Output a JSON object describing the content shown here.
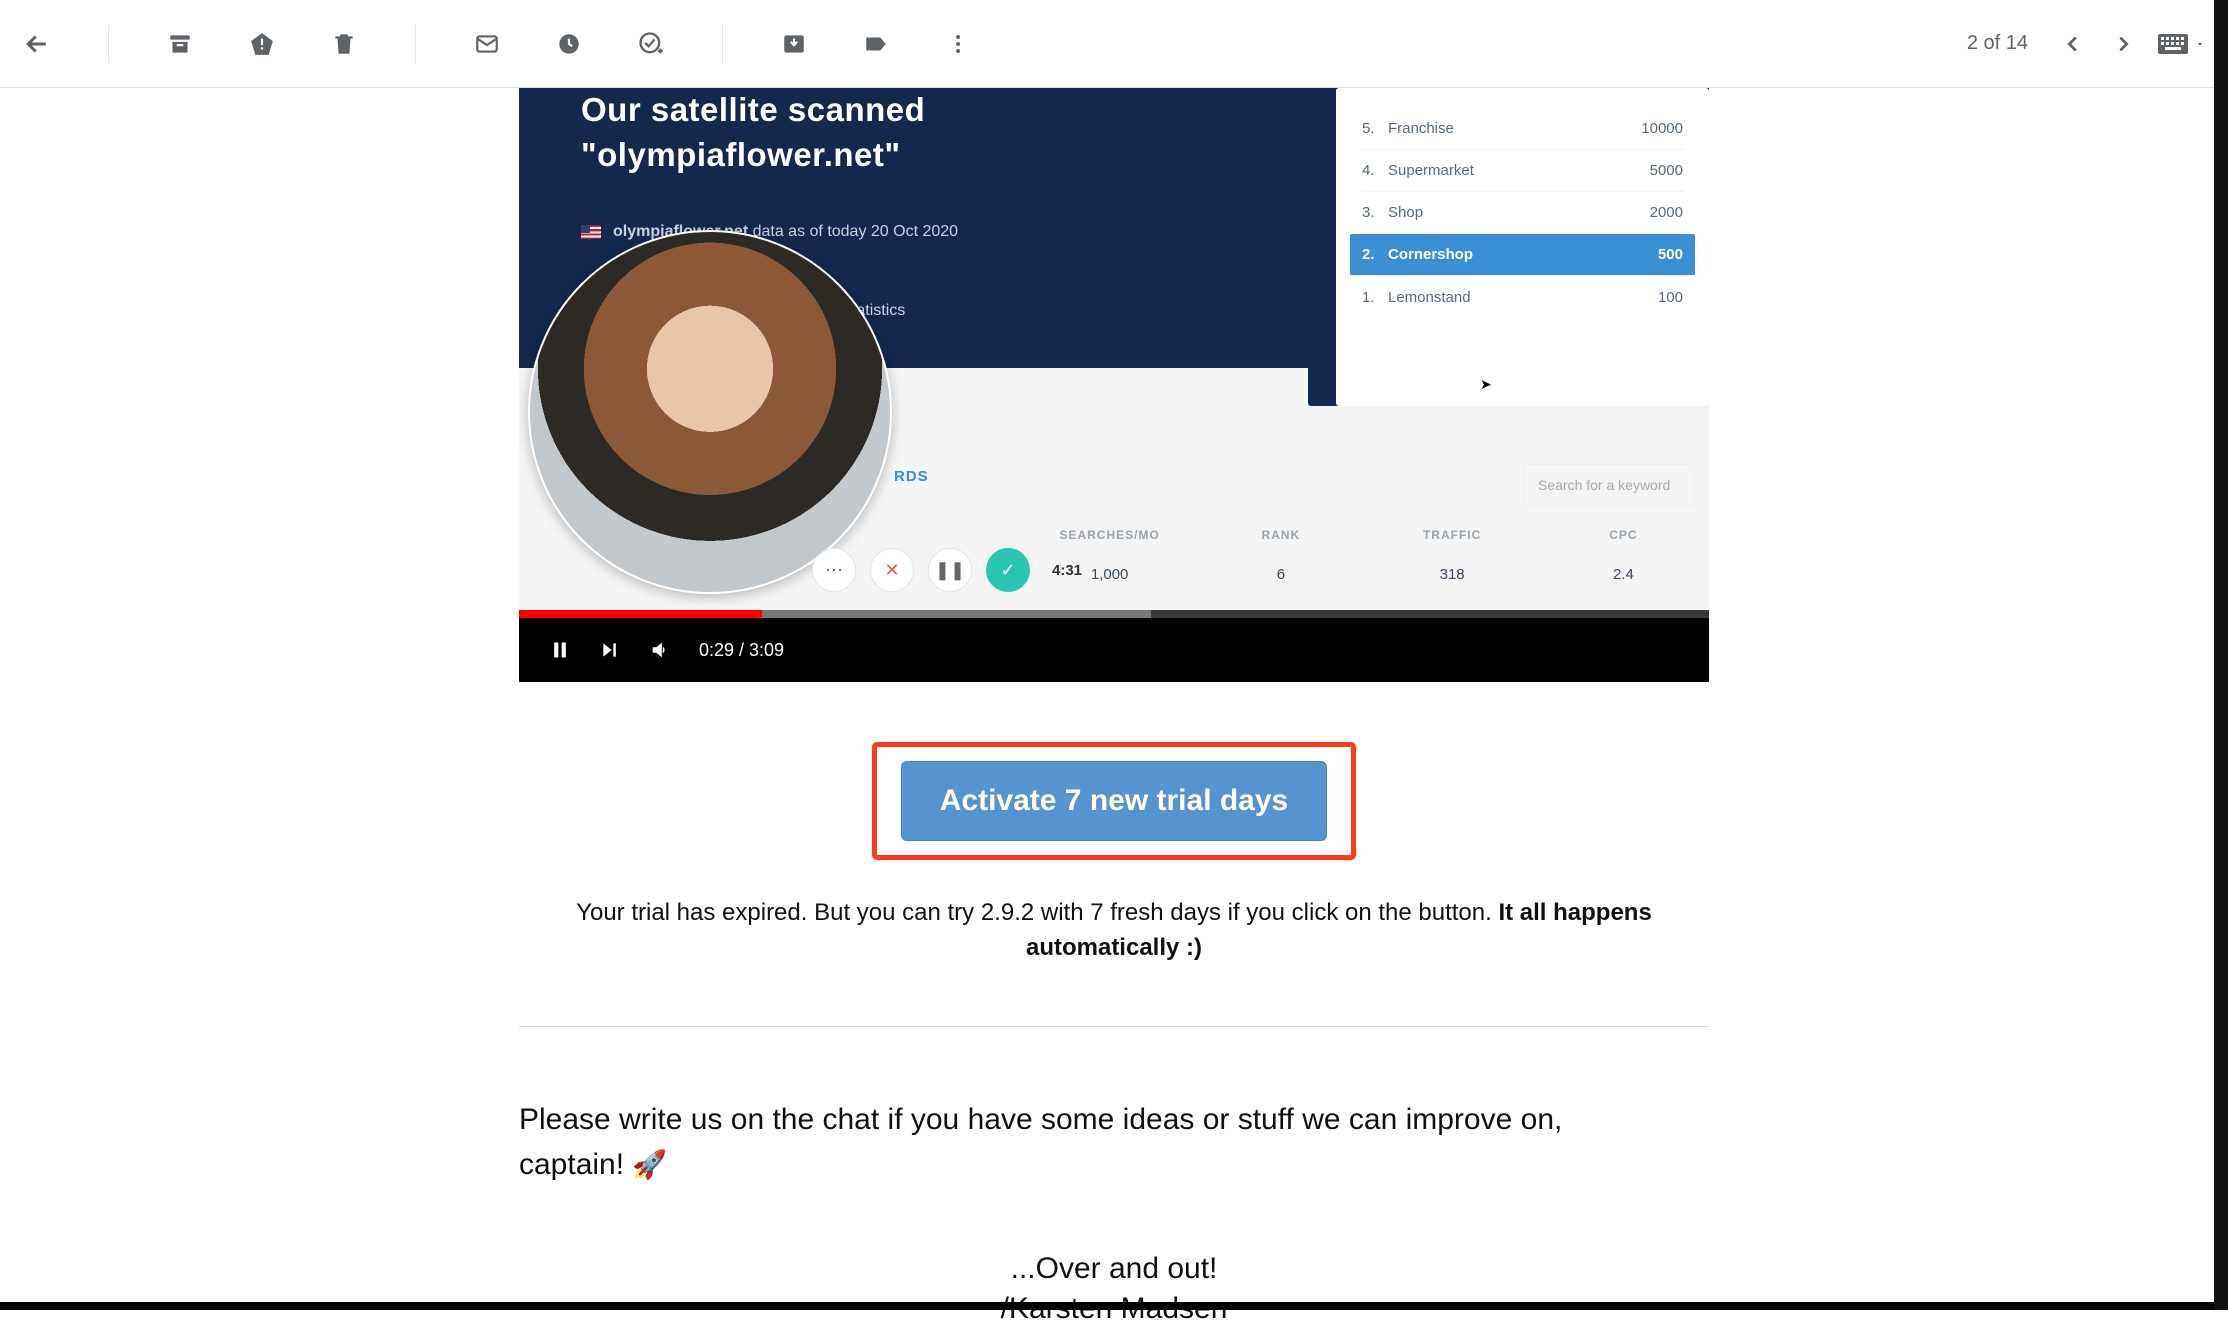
{
  "toolbar": {
    "page_counter": "2 of 14"
  },
  "video": {
    "hero_line1": "Our satellite scanned",
    "hero_line2": "\"olympiaflower.net\"",
    "domain": "olympiaflower.net",
    "meta_suffix": "data as of today 20 Oct 2020",
    "link_stat": "ink statistics",
    "rds_label": "RDS",
    "search_placeholder": "Search for a keyword",
    "chip_time": "4:31",
    "time_label": "0:29 / 3:09",
    "list": [
      {
        "n": "5.",
        "label": "Franchise",
        "value": "10000"
      },
      {
        "n": "4.",
        "label": "Supermarket",
        "value": "5000"
      },
      {
        "n": "3.",
        "label": "Shop",
        "value": "2000"
      },
      {
        "n": "2.",
        "label": "Cornershop",
        "value": "500"
      },
      {
        "n": "1.",
        "label": "Lemonstand",
        "value": "100"
      }
    ],
    "metrics_header": [
      "SEARCHES/MO",
      "RANK",
      "TRAFFIC",
      "CPC"
    ],
    "metrics_row": [
      "1,000",
      "6",
      "318",
      "2.4"
    ]
  },
  "cta": {
    "button": "Activate 7 new trial days",
    "text_a": "Your trial has expired. But you can try 2.9.2 with 7 fresh days if you click on the button. ",
    "text_b": "It all happens automatically :)"
  },
  "message": {
    "body": "Please write us on the chat if you have some ideas or stuff we can improve on, captain! ",
    "rocket": "🚀",
    "sign1": "...Over and out!",
    "sign2": "/Karsten Madsen"
  }
}
